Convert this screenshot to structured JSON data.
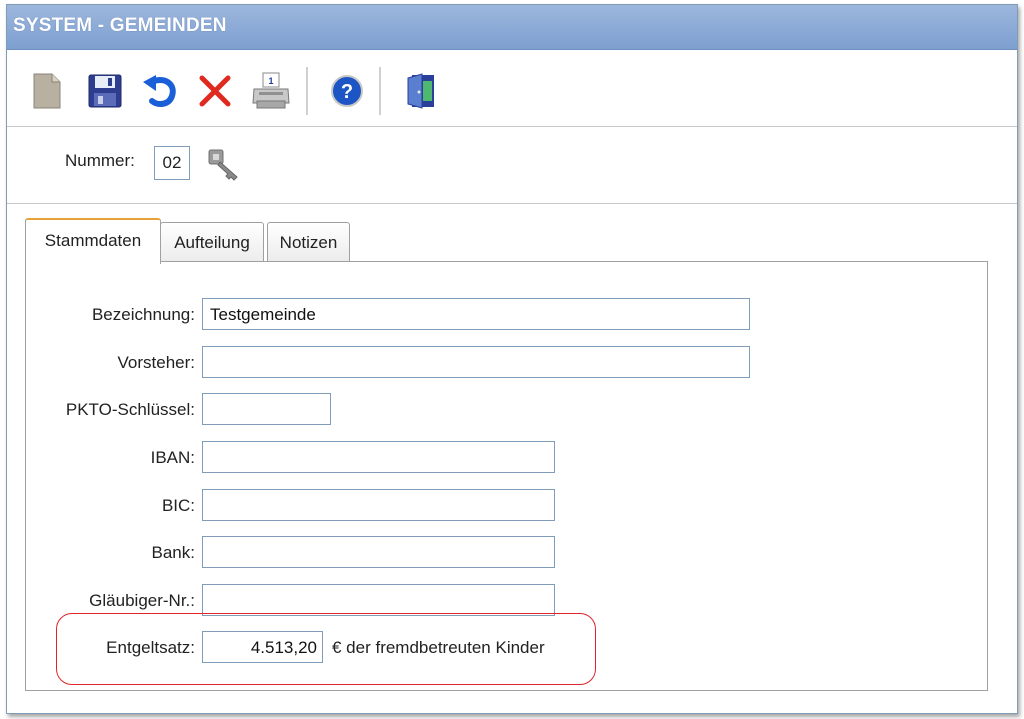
{
  "window": {
    "title": "SYSTEM - GEMEINDEN"
  },
  "toolbar": {
    "buttons": [
      {
        "icon": "new-document-icon",
        "label": "new"
      },
      {
        "icon": "save-icon",
        "label": "save"
      },
      {
        "icon": "undo-icon",
        "label": "undo"
      },
      {
        "icon": "delete-icon",
        "label": "delete"
      },
      {
        "icon": "print-icon",
        "label": "print"
      },
      {
        "icon": "help-icon",
        "label": "help"
      },
      {
        "icon": "exit-door-icon",
        "label": "exit"
      }
    ]
  },
  "header": {
    "number_label": "Nummer:",
    "number_value": "02",
    "key_icon": "key-search-icon"
  },
  "tabs": [
    {
      "label": "Stammdaten",
      "active": true
    },
    {
      "label": "Aufteilung",
      "active": false
    },
    {
      "label": "Notizen",
      "active": false
    }
  ],
  "form": {
    "bezeichnung": {
      "label": "Bezeichnung:",
      "value": "Testgemeinde"
    },
    "vorsteher": {
      "label": "Vorsteher:",
      "value": ""
    },
    "pkto": {
      "label": "PKTO-Schlüssel:",
      "value": ""
    },
    "iban": {
      "label": "IBAN:",
      "value": ""
    },
    "bic": {
      "label": "BIC:",
      "value": ""
    },
    "bank": {
      "label": "Bank:",
      "value": ""
    },
    "glaeubiger": {
      "label": "Gläubiger-Nr.:",
      "value": ""
    },
    "entgeltsatz": {
      "label": "Entgeltsatz:",
      "value": "4.513,20",
      "suffix": "€ der fremdbetreuten Kinder"
    }
  },
  "colors": {
    "title_bar": "#8aa8d6",
    "highlight": "#e0242a",
    "active_tab_accent": "#e8a23a"
  }
}
